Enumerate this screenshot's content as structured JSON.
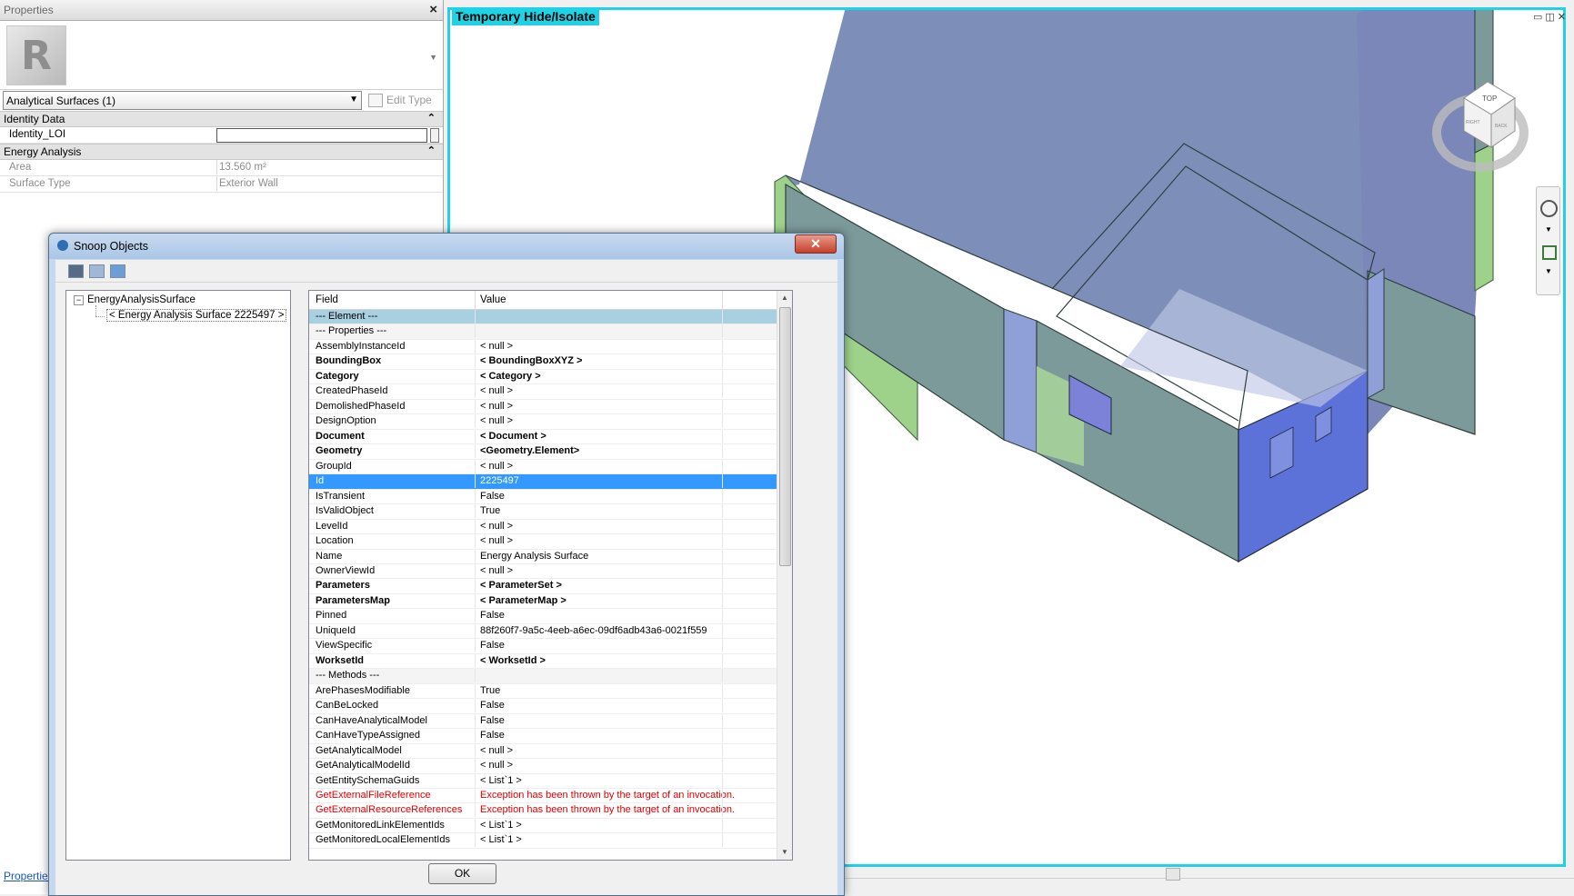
{
  "properties_panel": {
    "title": "Properties",
    "filter_value": "Analytical Surfaces (1)",
    "edit_type_label": "Edit Type",
    "groups": [
      {
        "label": "Identity Data",
        "rows": [
          {
            "name": "Identity_LOI",
            "value": ""
          }
        ]
      },
      {
        "label": "Energy Analysis",
        "rows": [
          {
            "name": "Area",
            "value": "13.560 m²"
          },
          {
            "name": "Surface Type",
            "value": "Exterior Wall"
          }
        ]
      }
    ],
    "bottom_link": "Properties"
  },
  "view": {
    "badge": "Temporary Hide/Isolate",
    "viewcube_top": "TOP",
    "viewcube_right": "RIGHT",
    "viewcube_back": "BACK"
  },
  "snoop": {
    "title": "Snoop Objects",
    "close_glyph": "✕",
    "tree": {
      "root": "EnergyAnalysisSurface",
      "child": "< Energy Analysis Surface  2225497 >"
    },
    "columns": {
      "field": "Field",
      "value": "Value"
    },
    "rows": [
      {
        "field": "--- Element ---",
        "value": "",
        "style": "hdr"
      },
      {
        "field": "  --- Properties ---",
        "value": "",
        "style": "sec"
      },
      {
        "field": "AssemblyInstanceId",
        "value": "< null >",
        "style": ""
      },
      {
        "field": "BoundingBox",
        "value": "< BoundingBoxXYZ >",
        "style": "bold"
      },
      {
        "field": "Category",
        "value": "< Category >",
        "style": "bold"
      },
      {
        "field": "CreatedPhaseId",
        "value": "< null >",
        "style": ""
      },
      {
        "field": "DemolishedPhaseId",
        "value": "< null >",
        "style": ""
      },
      {
        "field": "DesignOption",
        "value": "< null >",
        "style": ""
      },
      {
        "field": "Document",
        "value": "< Document >",
        "style": "bold"
      },
      {
        "field": "Geometry",
        "value": "<Geometry.Element>",
        "style": "bold"
      },
      {
        "field": "GroupId",
        "value": "< null >",
        "style": ""
      },
      {
        "field": "Id",
        "value": "2225497",
        "style": "sel"
      },
      {
        "field": "IsTransient",
        "value": "False",
        "style": ""
      },
      {
        "field": "IsValidObject",
        "value": "True",
        "style": ""
      },
      {
        "field": "LevelId",
        "value": "< null >",
        "style": ""
      },
      {
        "field": "Location",
        "value": "< null >",
        "style": ""
      },
      {
        "field": "Name",
        "value": "Energy Analysis Surface",
        "style": ""
      },
      {
        "field": "OwnerViewId",
        "value": "< null >",
        "style": ""
      },
      {
        "field": "Parameters",
        "value": "< ParameterSet >",
        "style": "bold"
      },
      {
        "field": "ParametersMap",
        "value": "< ParameterMap >",
        "style": "bold"
      },
      {
        "field": "Pinned",
        "value": "False",
        "style": ""
      },
      {
        "field": "UniqueId",
        "value": "88f260f7-9a5c-4eeb-a6ec-09df6adb43a6-0021f559",
        "style": ""
      },
      {
        "field": "ViewSpecific",
        "value": "False",
        "style": ""
      },
      {
        "field": "WorksetId",
        "value": "< WorksetId >",
        "style": "bold"
      },
      {
        "field": "  --- Methods ---",
        "value": "",
        "style": "sec"
      },
      {
        "field": "ArePhasesModifiable",
        "value": "True",
        "style": ""
      },
      {
        "field": "CanBeLocked",
        "value": "False",
        "style": ""
      },
      {
        "field": "CanHaveAnalyticalModel",
        "value": "False",
        "style": ""
      },
      {
        "field": "CanHaveTypeAssigned",
        "value": "False",
        "style": ""
      },
      {
        "field": "GetAnalyticalModel",
        "value": "< null >",
        "style": ""
      },
      {
        "field": "GetAnalyticalModelId",
        "value": "< null >",
        "style": ""
      },
      {
        "field": "GetEntitySchemaGuids",
        "value": "< List`1 >",
        "style": ""
      },
      {
        "field": "GetExternalFileReference",
        "value": "Exception has been thrown by the target of an invocation.",
        "style": "err"
      },
      {
        "field": "GetExternalResourceReferences",
        "value": "Exception has been thrown by the target of an invocation.",
        "style": "err"
      },
      {
        "field": "GetMonitoredLinkElementIds",
        "value": "< List`1 >",
        "style": ""
      },
      {
        "field": "GetMonitoredLocalElementIds",
        "value": "< List`1 >",
        "style": ""
      }
    ],
    "ok_label": "OK"
  },
  "colors": {
    "accent_cyan": "#20d2e6",
    "selection_blue": "#3399ff",
    "error_red": "#e20000",
    "header_row": "#a9d0e0"
  }
}
